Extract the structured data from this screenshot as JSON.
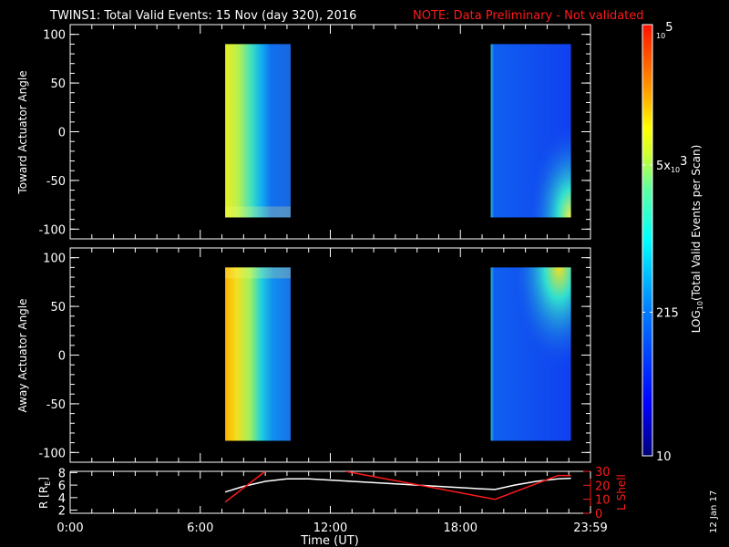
{
  "title": "TWINS1: Total Valid Events: 15 Nov (day 320), 2016",
  "note": "NOTE: Data Preliminary - Not validated",
  "date_stamp": "12 Jan 17",
  "colors": {
    "axis": "#ffffff",
    "note": "#ff1a1a",
    "lshell": "#ff1a1a",
    "radius": "#ffffff",
    "background": "#000000"
  },
  "chart_data": [
    {
      "type": "heatmap",
      "name": "toward",
      "ylabel": "Toward Actuator Angle",
      "ylim": [
        -110,
        110
      ],
      "yticks": [
        100,
        50,
        0,
        -50,
        -100
      ],
      "xlim_hours": [
        0,
        24
      ],
      "blocks": [
        {
          "t_start": 7.15,
          "t_end": 10.17,
          "angle_range": [
            -88,
            90
          ],
          "log_counts_left_to_right": [
            3.7,
            3.6,
            3.4,
            3.1,
            2.8,
            2.5,
            2.4,
            2.5
          ]
        },
        {
          "t_start": 19.4,
          "t_end": 23.1,
          "angle_range": [
            -88,
            90
          ],
          "log_counts_left_to_right": [
            2.2,
            2.0,
            2.0,
            2.0,
            2.0
          ],
          "note_hot_corner": "bottom-right"
        }
      ]
    },
    {
      "type": "heatmap",
      "name": "away",
      "ylabel": "Away Actuator Angle",
      "ylim": [
        -110,
        110
      ],
      "yticks": [
        100,
        50,
        0,
        -50,
        -100
      ],
      "xlim_hours": [
        0,
        24
      ],
      "blocks": [
        {
          "t_start": 7.15,
          "t_end": 10.17,
          "angle_range": [
            -88,
            90
          ],
          "log_counts_left_to_right": [
            4.1,
            4.0,
            3.7,
            3.3,
            2.9,
            2.6,
            2.5,
            2.5
          ]
        },
        {
          "t_start": 19.4,
          "t_end": 23.1,
          "angle_range": [
            -88,
            90
          ],
          "log_counts_left_to_right": [
            2.2,
            2.0,
            2.0,
            2.0,
            2.0
          ],
          "note_hot_corner": "top-right"
        }
      ]
    },
    {
      "type": "line",
      "name": "orbit",
      "xlabel": "Time (UT)",
      "xticks": [
        "0:00",
        "6:00",
        "12:00",
        "18:00",
        "23:59"
      ],
      "xtick_hours": [
        0,
        6,
        12,
        18,
        24
      ],
      "ylabel_left": "R [R",
      "ylabel_left_sub": "E",
      "ylabel_left_end": "]",
      "ylim_left": [
        1.5,
        8.2
      ],
      "yticks_left": [
        8,
        6,
        4,
        2
      ],
      "ylabel_right": "L Shell",
      "ylim_right": [
        0,
        30
      ],
      "yticks_right": [
        30,
        20,
        10,
        0
      ],
      "series": [
        {
          "name": "R",
          "axis": "left",
          "x": [
            7.15,
            8,
            9,
            10,
            11,
            12,
            13,
            14,
            15,
            16,
            17,
            18,
            19,
            19.6,
            20.5,
            21.5,
            22.5,
            23.1
          ],
          "y": [
            4.9,
            5.8,
            6.6,
            7.0,
            7.0,
            6.8,
            6.6,
            6.4,
            6.2,
            6.0,
            5.8,
            5.6,
            5.4,
            5.3,
            6.0,
            6.6,
            7.0,
            7.1
          ]
        },
        {
          "name": "L Shell",
          "axis": "right",
          "x": [
            7.15,
            9.0,
            null,
            12.7,
            19.6,
            22.5,
            23.1
          ],
          "y": [
            8,
            30,
            null,
            30,
            10,
            27,
            27
          ]
        }
      ]
    },
    {
      "type": "colorbar",
      "label_main": "LOG",
      "label_sub": "10",
      "label_rest": "(Total Valid Events per Scan)",
      "range": [
        10,
        100000
      ],
      "ticks": [
        {
          "value": 100000,
          "base": "10",
          "exp": "5",
          "prefix": ""
        },
        {
          "value": 5000,
          "base": "10",
          "exp": "3",
          "prefix": "5x"
        },
        {
          "value": 215,
          "base": "215",
          "exp": "",
          "prefix": ""
        },
        {
          "value": 10,
          "base": "10",
          "exp": "",
          "prefix": ""
        }
      ]
    }
  ]
}
